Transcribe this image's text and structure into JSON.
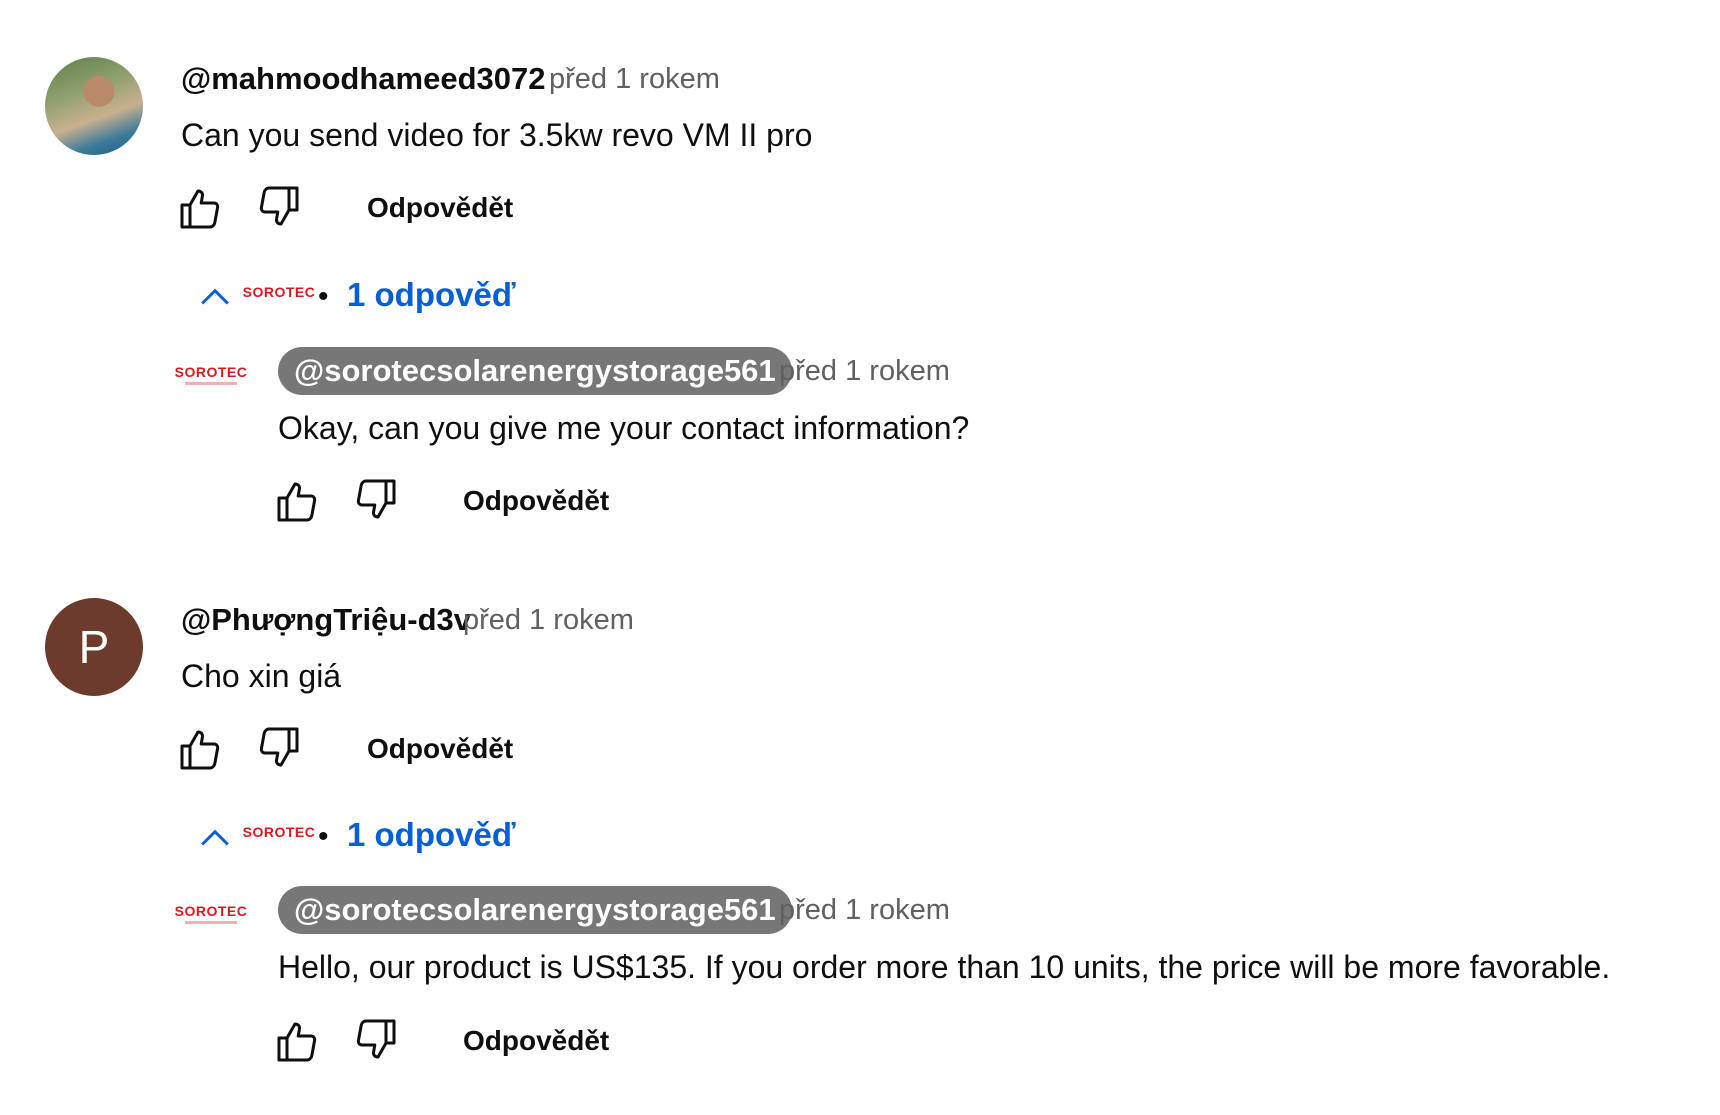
{
  "threads": [
    {
      "author": "@mahmoodhameed3072",
      "time": "před 1 rokem",
      "text": "Can you send video for 3.5kw revo VM II pro",
      "reply_label": "Odpovědět",
      "replies_link": "1 odpověď",
      "reply": {
        "channel_logo": "SOROTEC",
        "author": "@sorotecsolarenergystorage561",
        "time": "před 1 rokem",
        "text": "Okay, can you give me your contact information?",
        "reply_label": "Odpovědět"
      }
    },
    {
      "author": "@PhượngTriệu-d3v",
      "avatar_letter": "P",
      "time": "před 1 rokem",
      "text": "Cho xin giá",
      "reply_label": "Odpovědět",
      "replies_link": "1 odpověď",
      "reply": {
        "channel_logo": "SOROTEC",
        "author": "@sorotecsolarenergystorage561",
        "time": "před 1 rokem",
        "text": "Hello, our product is US$135. If you order more than 10 units, the price will be more favorable.",
        "reply_label": "Odpovědět"
      }
    }
  ],
  "colors": {
    "link": "#065fd4",
    "chip": "#777777",
    "brand": "#d71920",
    "avatar_p": "#6d3b2e"
  },
  "icons": [
    "thumb-up-icon",
    "thumb-down-icon",
    "chevron-up-icon"
  ]
}
